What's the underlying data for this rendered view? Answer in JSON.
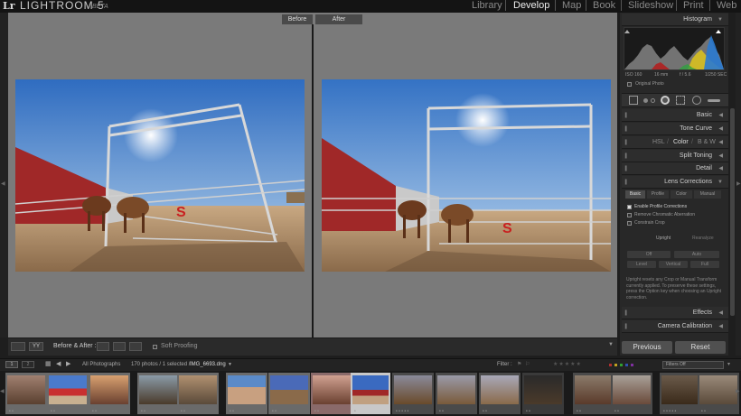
{
  "app": {
    "logo": "Lr",
    "name": "LIGHTROOM 5",
    "beta": "BETA"
  },
  "modules": [
    "Library",
    "Develop",
    "Map",
    "Book",
    "Slideshow",
    "Print",
    "Web"
  ],
  "active_module": "Develop",
  "view": {
    "before_label": "Before",
    "after_label": "After"
  },
  "right_panel": {
    "histogram_title": "Histogram",
    "hist_info": {
      "iso": "ISO 160",
      "focal": "16 mm",
      "aperture": "f / 5.6",
      "shutter": "1/250 SEC"
    },
    "original_photo": "Original Photo",
    "basic": "Basic",
    "tone_curve": "Tone Curve",
    "hsl": "HSL",
    "color": "Color",
    "bw": "B & W",
    "split_toning": "Split Toning",
    "detail": "Detail",
    "lens_corrections": "Lens Corrections",
    "lens_tabs": [
      "Basic",
      "Profile",
      "Color",
      "Manual"
    ],
    "lens_options": [
      "Enable Profile Corrections",
      "Remove Chromatic Aberration",
      "Constrain Crop"
    ],
    "upright_label": "Upright",
    "reanalyze": "Reanalyze",
    "upright_btns": [
      "Off",
      "Auto",
      "Level",
      "Vertical",
      "Full"
    ],
    "upright_note": "Upright resets any Crop or Manual Transform currently applied. To preserve these settings, press the Option key when choosing an Upright correction.",
    "effects": "Effects",
    "camera_calibration": "Camera Calibration"
  },
  "toolbar": {
    "mode_label": "YY",
    "before_after": "Before & After :",
    "soft_proofing": "Soft Proofing"
  },
  "buttons": {
    "previous": "Previous",
    "reset": "Reset"
  },
  "filmstrip_bar": {
    "page1": "1",
    "page2": "2",
    "source": "All Photographs",
    "count": "170 photos / 1 selected /",
    "filename": "IMG_6693.dng",
    "filter_label": "Filter :",
    "filters_off": "Filters Off"
  },
  "colors": {
    "accent": "#e8e8e8",
    "panel": "#282828",
    "view_bg": "#7a7a7a"
  }
}
